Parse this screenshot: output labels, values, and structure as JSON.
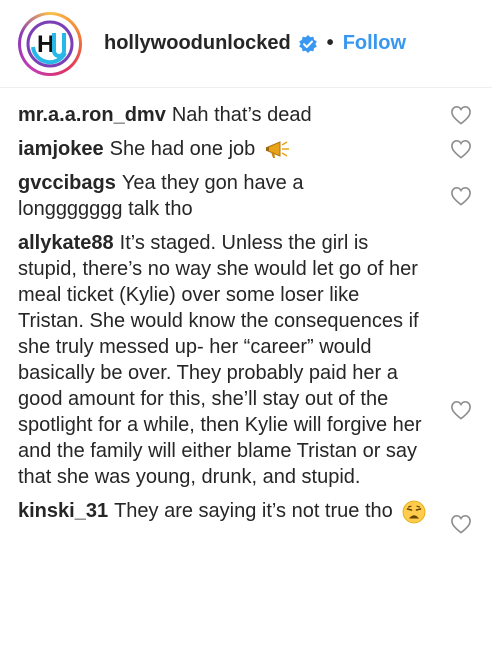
{
  "header": {
    "username": "hollywoodunlocked",
    "separator": "•",
    "follow_label": "Follow"
  },
  "comments": [
    {
      "user": "mr.a.a.ron_dmv",
      "text": "Nah that’s dead"
    },
    {
      "user": "iamjokee",
      "text": "She had one job"
    },
    {
      "user": "gvccibags",
      "text": "Yea they gon have a longgggggg talk tho"
    },
    {
      "user": "allykate88",
      "text": "It’s staged. Unless the girl is stupid, there’s no way she would let go of her meal ticket (Kylie) over some loser like Tristan. She would know the consequences if she truly messed up- her “career” would basically be over. They probably paid her a good amount for this, she’ll stay out of the spotlight for a while, then Kylie will forgive her and the family will either blame Tristan or say that she was young, drunk, and stupid."
    },
    {
      "user": "kinski_31",
      "text": "They are saying it’s not true tho"
    }
  ],
  "colors": {
    "accent": "#3897f0",
    "text": "#262626",
    "heart_outline": "#8e8e8e"
  },
  "icons": {
    "verified": "verified-badge-icon",
    "like": "heart-outline-icon",
    "megaphone": "megaphone-emoji",
    "weary_face": "weary-face-emoji"
  }
}
